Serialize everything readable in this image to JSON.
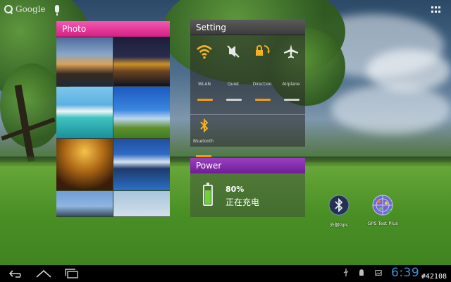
{
  "top_bar": {
    "search_label": "Google"
  },
  "photo_widget": {
    "title": "Photo",
    "accent": "#e0248e",
    "photos": [
      "city-night-river",
      "bridge-lights",
      "boat-lagoon",
      "blue-sky-field",
      "golden-path",
      "coastal-city",
      "suspension-bridge",
      "pale-sky"
    ]
  },
  "setting_widget": {
    "title": "Setting",
    "toggles": [
      {
        "label": "WLAN",
        "icon": "wifi-icon",
        "state_color": "#f39c12"
      },
      {
        "label": "Quiet",
        "icon": "speaker-mute-icon",
        "state_color": "#d0d0d0"
      },
      {
        "label": "Direction",
        "icon": "rotation-lock-icon",
        "state_color": "#f39c12"
      },
      {
        "label": "Airplane",
        "icon": "airplane-icon",
        "state_color": "#d0d0d0"
      }
    ],
    "bluetooth": {
      "label": "Bluetooth",
      "icon": "bluetooth-icon",
      "state_color": "#f39c12"
    }
  },
  "power_widget": {
    "title": "Power",
    "percent": "80%",
    "status": "正在充电",
    "battery_level": 0.8,
    "accent": "#7a2aa8"
  },
  "shortcuts": [
    {
      "label": "外部Gps",
      "icon": "bluetooth-gps-icon"
    },
    {
      "label": "GPS Test Plus",
      "icon": "gps-radar-icon"
    }
  ],
  "nav_bar": {
    "time": "6:39",
    "watermark": "#42108"
  }
}
